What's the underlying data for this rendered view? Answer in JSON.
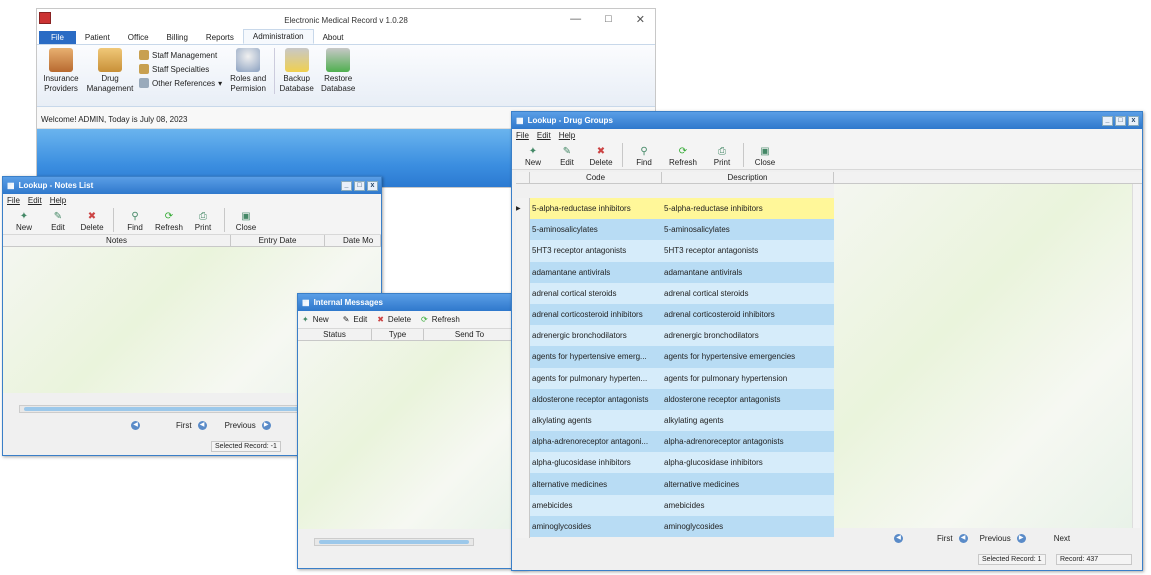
{
  "main": {
    "title": "Electronic Medical Record v 1.0.28",
    "tabs": [
      "File",
      "Patient",
      "Office",
      "Billing",
      "Reports",
      "Administration",
      "About"
    ],
    "ribbon": {
      "insurance": "Insurance Providers",
      "drug": "Drug Management",
      "staff_mgmt": "Staff Management",
      "staff_spec": "Staff Specialties",
      "other_refs": "Other References",
      "roles": "Roles and Permision",
      "backup": "Backup Database",
      "restore": "Restore Database"
    },
    "welcome": "Welcome! ADMIN, Today is July 08, 2023"
  },
  "notes": {
    "title": "Lookup - Notes List",
    "menu": [
      "File",
      "Edit",
      "Help"
    ],
    "toolbar": [
      "New",
      "Edit",
      "Delete",
      "Find",
      "Refresh",
      "Print",
      "Close"
    ],
    "columns": [
      "Notes",
      "Entry Date",
      "Date Mo"
    ],
    "nav": {
      "first": "First",
      "previous": "Previous"
    },
    "status": "Selected Record: -1"
  },
  "messages": {
    "title": "Internal Messages",
    "toolbar": [
      "New",
      "Edit",
      "Delete",
      "Refresh"
    ],
    "columns": [
      "Status",
      "Type",
      "Send To"
    ]
  },
  "drugs": {
    "title": "Lookup - Drug Groups",
    "menu": [
      "File",
      "Edit",
      "Help"
    ],
    "toolbar": [
      "New",
      "Edit",
      "Delete",
      "Find",
      "Refresh",
      "Print",
      "Close"
    ],
    "columns": [
      "Code",
      "Description"
    ],
    "rows": [
      [
        "5-alpha-reductase inhibitors",
        "5-alpha-reductase inhibitors"
      ],
      [
        "5-aminosalicylates",
        "5-aminosalicylates"
      ],
      [
        "5HT3 receptor antagonists",
        "5HT3 receptor antagonists"
      ],
      [
        "adamantane antivirals",
        "adamantane antivirals"
      ],
      [
        "adrenal cortical steroids",
        "adrenal cortical steroids"
      ],
      [
        "adrenal corticosteroid inhibitors",
        "adrenal corticosteroid inhibitors"
      ],
      [
        "adrenergic bronchodilators",
        "adrenergic bronchodilators"
      ],
      [
        "agents for hypertensive emerg...",
        "agents for hypertensive emergencies"
      ],
      [
        "agents for pulmonary hyperten...",
        "agents for pulmonary hypertension"
      ],
      [
        "aldosterone receptor antagonists",
        "aldosterone receptor antagonists"
      ],
      [
        "alkylating agents",
        "alkylating agents"
      ],
      [
        "alpha-adrenoreceptor antagoni...",
        "alpha-adrenoreceptor antagonists"
      ],
      [
        "alpha-glucosidase inhibitors",
        "alpha-glucosidase inhibitors"
      ],
      [
        "alternative medicines",
        "alternative medicines"
      ],
      [
        "amebicides",
        "amebicides"
      ],
      [
        "aminoglycosides",
        "aminoglycosides"
      ]
    ],
    "nav": {
      "first": "First",
      "previous": "Previous",
      "next": "Next"
    },
    "status_selected": "Selected Record: 1",
    "status_record": "Record: 437"
  }
}
